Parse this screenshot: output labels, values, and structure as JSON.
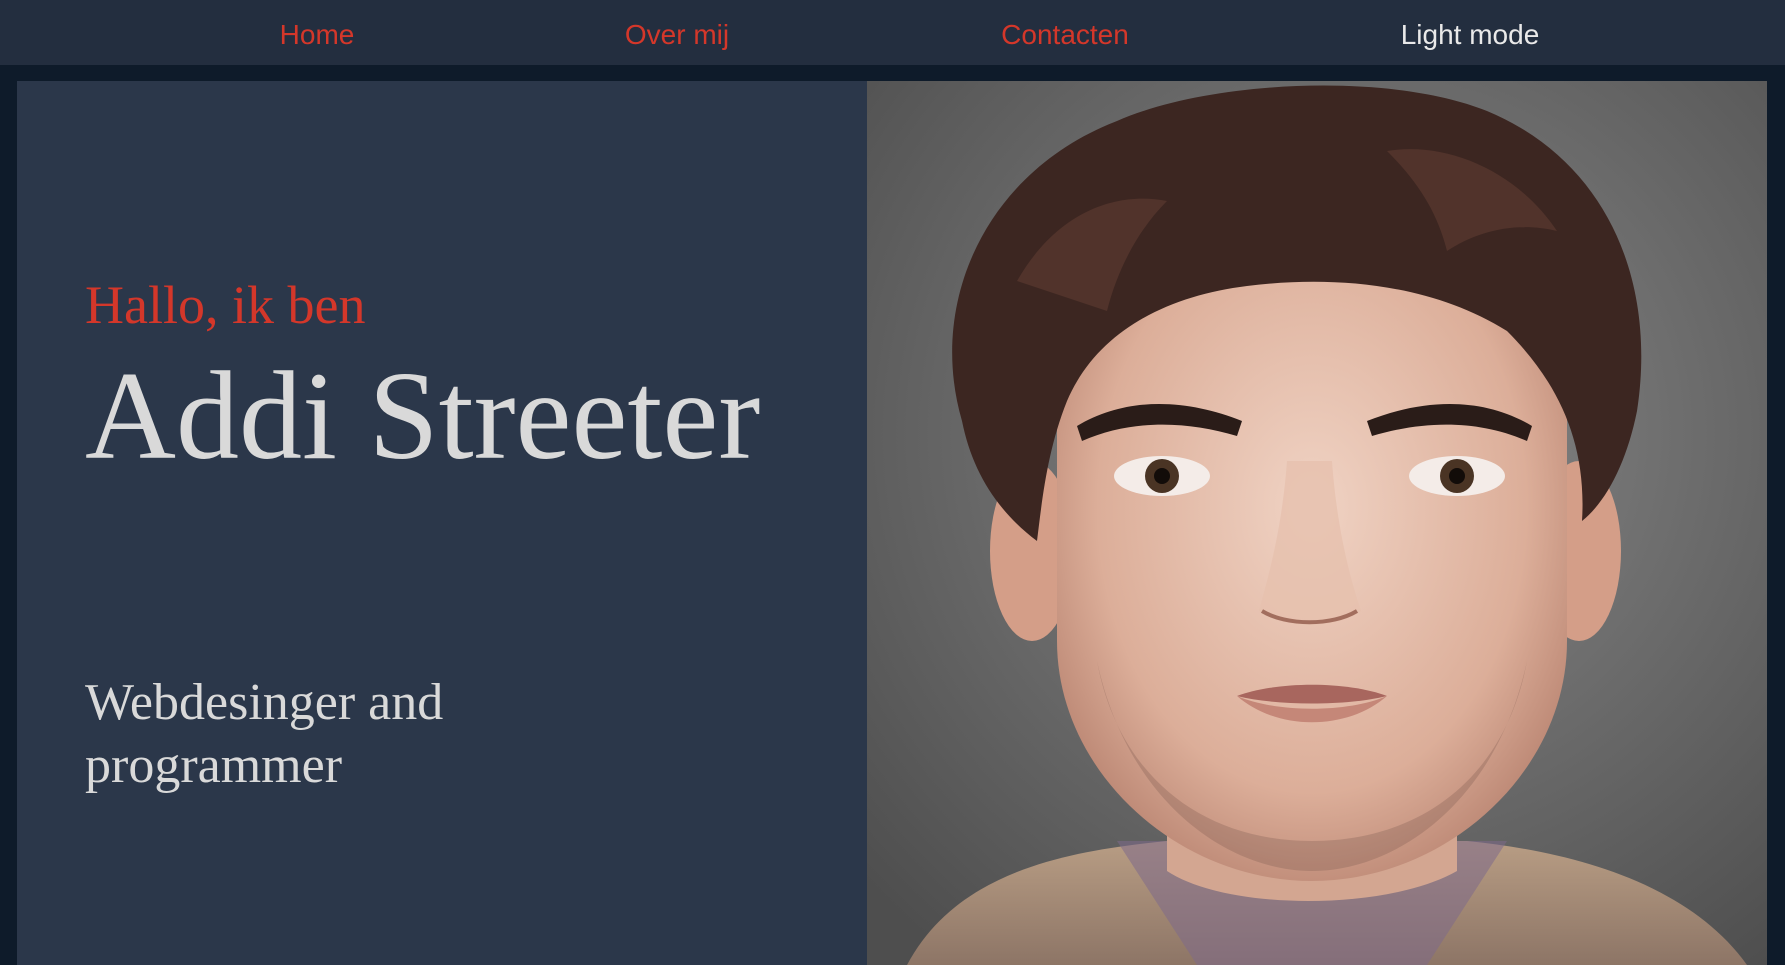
{
  "nav": {
    "home": "Home",
    "about": "Over mij",
    "contact": "Contacten",
    "mode_toggle": "Light mode"
  },
  "hero": {
    "greeting": "Hallo, ik ben",
    "name": "Addi Streeter",
    "tagline": "Webdesinger and programmer"
  },
  "colors": {
    "accent": "#d4372a",
    "nav_background": "#232e3f",
    "panel_background": "#2b374a",
    "page_background": "#0e1b2a",
    "text_light": "#d9d9d9"
  }
}
